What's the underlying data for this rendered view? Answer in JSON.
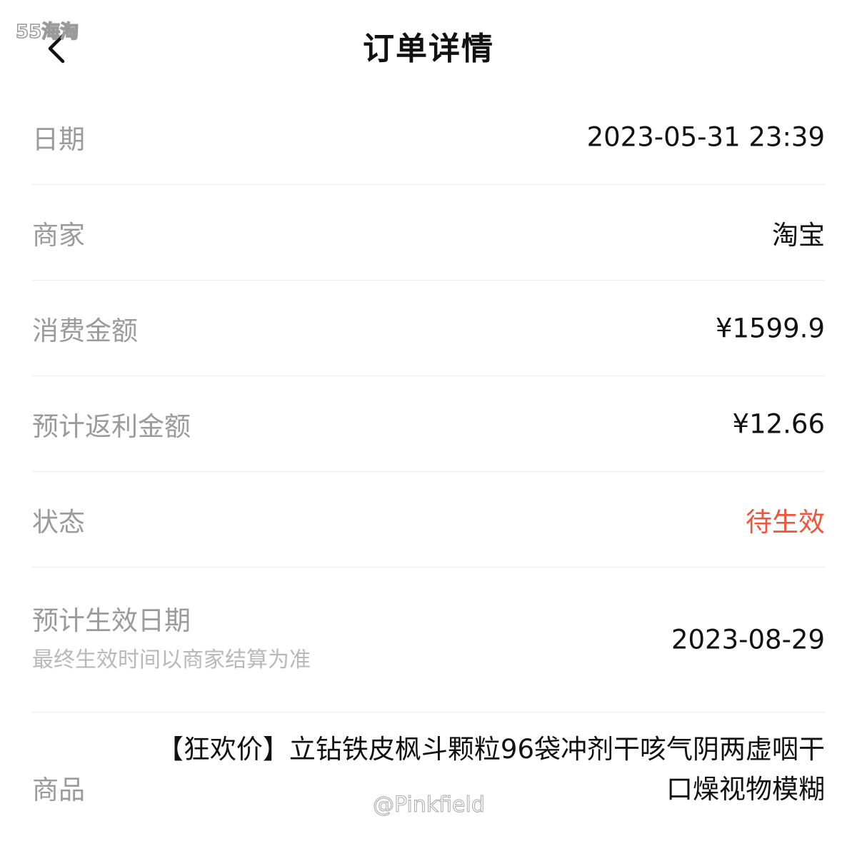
{
  "watermark": {
    "top_left": "55海淘",
    "bottom": "@Pinkfield"
  },
  "header": {
    "back_icon": "chevron-left-icon",
    "title": "订单详情"
  },
  "details": {
    "date": {
      "label": "日期",
      "value": "2023-05-31 23:39"
    },
    "merchant": {
      "label": "商家",
      "value": "淘宝"
    },
    "amount": {
      "label": "消费金额",
      "value": "¥1599.9"
    },
    "rebate": {
      "label": "预计返利金额",
      "value": "¥12.66"
    },
    "status": {
      "label": "状态",
      "value": "待生效",
      "color": "#f0553c"
    },
    "effective_date": {
      "label": "预计生效日期",
      "note": "最终生效时间以商家结算为准",
      "value": "2023-08-29"
    },
    "goods": {
      "label": "商品",
      "value": "【狂欢价】立钻铁皮枫斗颗粒96袋冲剂干咳气阴两虚咽干口燥视物模糊"
    }
  }
}
